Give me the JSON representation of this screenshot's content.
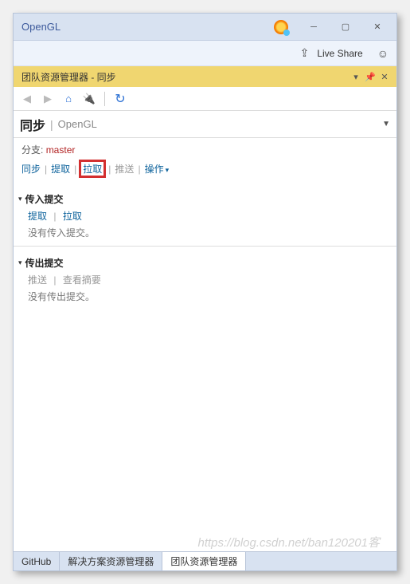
{
  "titlebar": {
    "title": "OpenGL"
  },
  "toolbar": {
    "live_share": "Live Share"
  },
  "panel": {
    "title": "团队资源管理器 - 同步"
  },
  "breadcrumb": {
    "main": "同步",
    "sub": "OpenGL"
  },
  "branch": {
    "label": "分支:",
    "name": "master"
  },
  "actions": {
    "sync": "同步",
    "fetch": "提取",
    "pull": "拉取",
    "push": "推送",
    "ops": "操作"
  },
  "incoming": {
    "title": "传入提交",
    "fetch": "提取",
    "pull": "拉取",
    "empty": "没有传入提交。"
  },
  "outgoing": {
    "title": "传出提交",
    "push": "推送",
    "summary": "查看摘要",
    "empty": "没有传出提交。"
  },
  "tabs": {
    "github": "GitHub",
    "solution": "解决方案资源管理器",
    "team": "团队资源管理器"
  },
  "watermark": "https://blog.csdn.net/ban120201客"
}
